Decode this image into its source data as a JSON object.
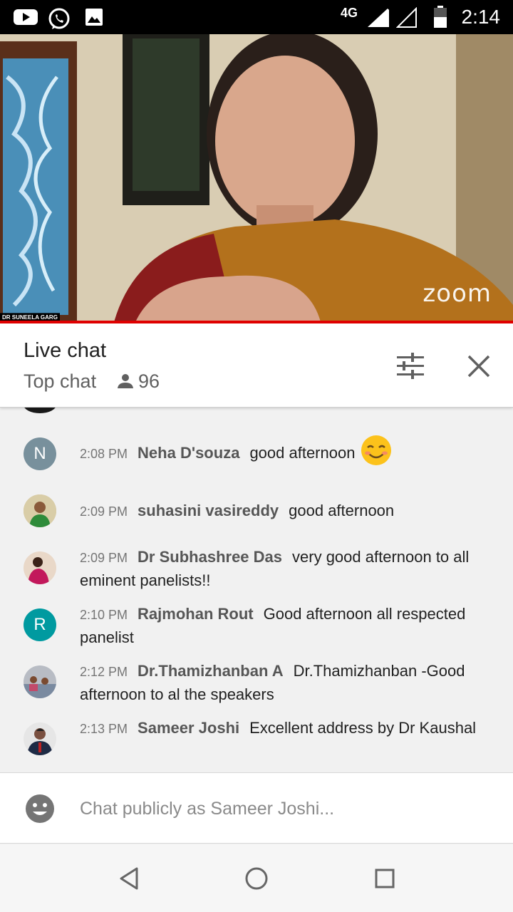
{
  "status_bar": {
    "network": "4G",
    "time": "2:14",
    "icons": [
      "youtube-icon",
      "whatsapp-icon",
      "gallery-icon",
      "signal-icon",
      "battery-icon"
    ]
  },
  "video": {
    "speaker_name": "DR SUNEELA GARG",
    "watermark": "zoom"
  },
  "chat_header": {
    "title": "Live chat",
    "mode": "Top chat",
    "viewer_count": "96",
    "icons": [
      "filter-icon",
      "close-icon"
    ]
  },
  "messages": [
    {
      "time": "2:08 PM",
      "author": "Neha D'souza",
      "text": "good afternoon",
      "avatar_letter": "N",
      "avatar_color": "#78909c",
      "emoji": "smiling-face-icon"
    },
    {
      "time": "2:09 PM",
      "author": "suhasini vasireddy",
      "text": "good afternoon",
      "avatar_letter": "",
      "avatar_color": "#c8b27a"
    },
    {
      "time": "2:09 PM",
      "author": "Dr Subhashree Das",
      "text": "very good afternoon to all eminent panelists!!",
      "avatar_letter": "",
      "avatar_color": "#a0522d"
    },
    {
      "time": "2:10 PM",
      "author": "Rajmohan Rout",
      "text": "Good afternoon all respected panelist",
      "avatar_letter": "R",
      "avatar_color": "#009aa0"
    },
    {
      "time": "2:12 PM",
      "author": "Dr.Thamizhanban A",
      "text": "Dr.Thamizhanban -Good afternoon to al the speakers",
      "avatar_letter": "",
      "avatar_color": "#8a8f9a"
    },
    {
      "time": "2:13 PM",
      "author": "Sameer Joshi",
      "text": "Excellent address by Dr Kaushal",
      "avatar_letter": "",
      "avatar_color": "#2b3550"
    }
  ],
  "input": {
    "placeholder": "Chat publicly as Sameer Joshi..."
  },
  "nav_bar": {
    "icons": [
      "back-icon",
      "home-icon",
      "recents-icon"
    ]
  },
  "colors": {
    "accent_red": "#e00000",
    "header_bg": "#ffffff",
    "chat_bg": "#f1f1f1"
  }
}
